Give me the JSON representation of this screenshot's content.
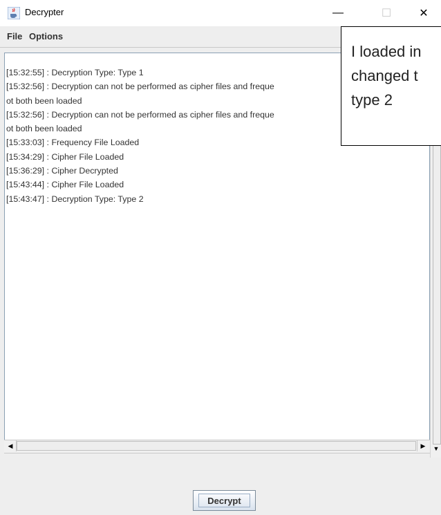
{
  "window": {
    "title": "Decrypter",
    "minimize_glyph": "—",
    "maximize_glyph": "☐",
    "close_glyph": "✕",
    "app_icon": "java-cup-icon"
  },
  "menu": {
    "file": "File",
    "options": "Options"
  },
  "log": {
    "lines": [
      "[15:32:55] : Decryption Type: Type 1",
      "[15:32:56] : Decryption can not be performed as cipher files and freque",
      "ot both been loaded",
      "[15:32:56] : Decryption can not be performed as cipher files and freque",
      "ot both been loaded",
      "[15:33:03] : Frequency File Loaded",
      "[15:34:29] : Cipher File Loaded",
      "[15:36:29] : Cipher Decrypted",
      "[15:43:44] : Cipher File Loaded",
      "[15:43:47] : Decryption Type: Type 2"
    ]
  },
  "scrollbars": {
    "left_arrow": "◀",
    "right_arrow": "▶",
    "down_arrow": "▼"
  },
  "buttons": {
    "decrypt": "Decrypt"
  },
  "callout": {
    "lines": [
      "I loaded in",
      "changed t",
      "type 2"
    ]
  }
}
